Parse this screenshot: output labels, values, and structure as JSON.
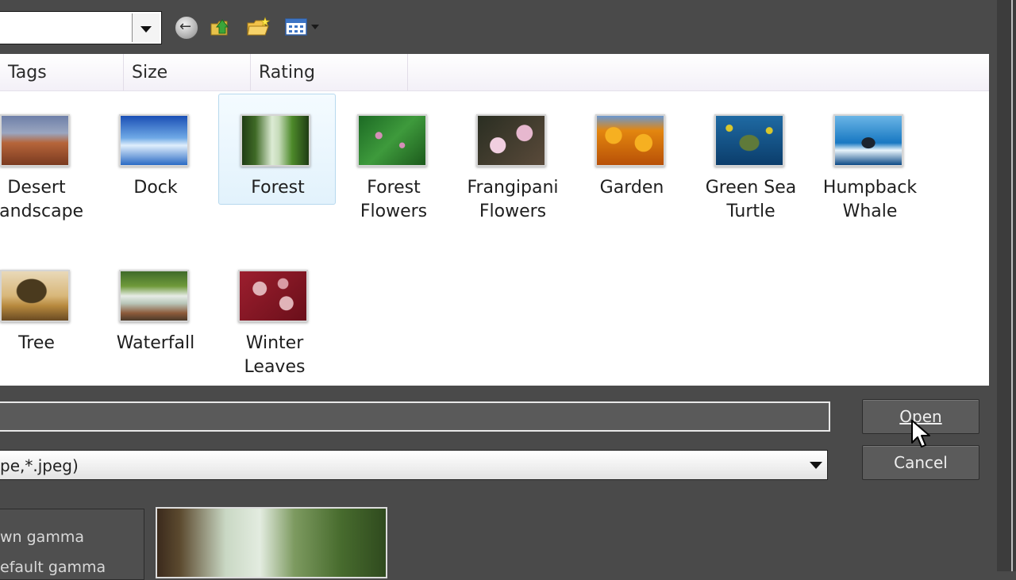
{
  "toolbar": {
    "lookin_value": "",
    "icons": [
      "back-arrow-icon",
      "up-folder-icon",
      "new-folder-icon",
      "views-menu-icon"
    ]
  },
  "columns": [
    "Tags",
    "Size",
    "Rating"
  ],
  "files": [
    {
      "name": "Desert Landscape",
      "line1": "Desert",
      "line2": "Landscape",
      "selected": false,
      "colors": [
        "#6e7fa8",
        "#b6653a",
        "#7a3a20"
      ]
    },
    {
      "name": "Dock",
      "line1": "Dock",
      "line2": "",
      "selected": false,
      "colors": [
        "#1a4fb5",
        "#6fa9e6",
        "#dfeefc"
      ]
    },
    {
      "name": "Forest",
      "line1": "Forest",
      "line2": "",
      "selected": true,
      "colors": [
        "#1f3c14",
        "#dcebd4",
        "#69a43a"
      ]
    },
    {
      "name": "Forest Flowers",
      "line1": "Forest",
      "line2": "Flowers",
      "selected": false,
      "colors": [
        "#1c6a24",
        "#3e9a3c",
        "#d58fb8"
      ]
    },
    {
      "name": "Frangipani Flowers",
      "line1": "Frangipani",
      "line2": "Flowers",
      "selected": false,
      "colors": [
        "#2a2e22",
        "#e7b8cf",
        "#5a4a3a"
      ]
    },
    {
      "name": "Garden",
      "line1": "Garden",
      "line2": "",
      "selected": false,
      "colors": [
        "#e3860f",
        "#f6b021",
        "#b85007"
      ]
    },
    {
      "name": "Green Sea Turtle",
      "line1": "Green Sea",
      "line2": "Turtle",
      "selected": false,
      "colors": [
        "#0b3d6b",
        "#1f6aa3",
        "#d9c72c"
      ]
    },
    {
      "name": "Humpback Whale",
      "line1": "Humpback",
      "line2": "Whale",
      "selected": false,
      "colors": [
        "#1878c2",
        "#6ab5e6",
        "#0c4a86"
      ]
    },
    {
      "name": "Tree",
      "line1": "Tree",
      "line2": "",
      "selected": false,
      "colors": [
        "#e9d9b8",
        "#b7893e",
        "#3a2c18"
      ]
    },
    {
      "name": "Waterfall",
      "line1": "Waterfall",
      "line2": "",
      "selected": false,
      "colors": [
        "#3f6a2a",
        "#e6ece6",
        "#8c5a3a"
      ]
    },
    {
      "name": "Winter Leaves",
      "line1": "Winter",
      "line2": "Leaves",
      "selected": false,
      "colors": [
        "#9c1e2e",
        "#e0b3b8",
        "#6a0f1a"
      ]
    }
  ],
  "bottom": {
    "filename_value": "",
    "filetype_value": "pe,*.jpeg)",
    "open_label": "Open",
    "cancel_label": "Cancel",
    "option1": "wn gamma",
    "option2": "efault gamma"
  },
  "colors": {
    "background": "#4a4a4a",
    "panel": "#ffffff",
    "selection": "#e2f2fc"
  }
}
